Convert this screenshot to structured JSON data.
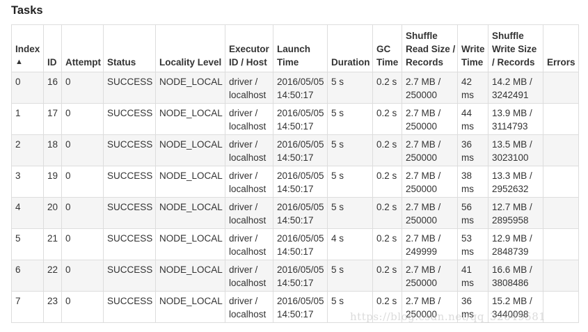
{
  "title": "Tasks",
  "columns": [
    {
      "line1": "Index",
      "line2": "▲"
    },
    {
      "line1": "ID",
      "line2": ""
    },
    {
      "line1": "Attempt",
      "line2": ""
    },
    {
      "line1": "Status",
      "line2": ""
    },
    {
      "line1": "Locality Level",
      "line2": ""
    },
    {
      "line1": "Executor",
      "line2": "ID / Host"
    },
    {
      "line1": "Launch",
      "line2": "Time"
    },
    {
      "line1": "Duration",
      "line2": ""
    },
    {
      "line1": "GC",
      "line2": "Time"
    },
    {
      "line1": "Shuffle",
      "line2": "Read Size /",
      "line3": "Records"
    },
    {
      "line1": "Write",
      "line2": "Time"
    },
    {
      "line1": "Shuffle",
      "line2": "Write Size",
      "line3": "/ Records"
    },
    {
      "line1": "Errors",
      "line2": ""
    }
  ],
  "rows": [
    {
      "index": "0",
      "id": "16",
      "attempt": "0",
      "status": "SUCCESS",
      "locality": "NODE_LOCAL",
      "executor1": "driver /",
      "executor2": "localhost",
      "launch1": "2016/05/05",
      "launch2": "14:50:17",
      "duration": "5 s",
      "gc": "0.2 s",
      "read1": "2.7 MB /",
      "read2": "250000",
      "write1": "42",
      "write2": "ms",
      "wsize1": "14.2 MB /",
      "wsize2": "3242491",
      "errors": ""
    },
    {
      "index": "1",
      "id": "17",
      "attempt": "0",
      "status": "SUCCESS",
      "locality": "NODE_LOCAL",
      "executor1": "driver /",
      "executor2": "localhost",
      "launch1": "2016/05/05",
      "launch2": "14:50:17",
      "duration": "5 s",
      "gc": "0.2 s",
      "read1": "2.7 MB /",
      "read2": "250000",
      "write1": "44",
      "write2": "ms",
      "wsize1": "13.9 MB /",
      "wsize2": "3114793",
      "errors": ""
    },
    {
      "index": "2",
      "id": "18",
      "attempt": "0",
      "status": "SUCCESS",
      "locality": "NODE_LOCAL",
      "executor1": "driver /",
      "executor2": "localhost",
      "launch1": "2016/05/05",
      "launch2": "14:50:17",
      "duration": "5 s",
      "gc": "0.2 s",
      "read1": "2.7 MB /",
      "read2": "250000",
      "write1": "36",
      "write2": "ms",
      "wsize1": "13.5 MB /",
      "wsize2": "3023100",
      "errors": ""
    },
    {
      "index": "3",
      "id": "19",
      "attempt": "0",
      "status": "SUCCESS",
      "locality": "NODE_LOCAL",
      "executor1": "driver /",
      "executor2": "localhost",
      "launch1": "2016/05/05",
      "launch2": "14:50:17",
      "duration": "5 s",
      "gc": "0.2 s",
      "read1": "2.7 MB /",
      "read2": "250000",
      "write1": "38",
      "write2": "ms",
      "wsize1": "13.3 MB /",
      "wsize2": "2952632",
      "errors": ""
    },
    {
      "index": "4",
      "id": "20",
      "attempt": "0",
      "status": "SUCCESS",
      "locality": "NODE_LOCAL",
      "executor1": "driver /",
      "executor2": "localhost",
      "launch1": "2016/05/05",
      "launch2": "14:50:17",
      "duration": "5 s",
      "gc": "0.2 s",
      "read1": "2.7 MB /",
      "read2": "250000",
      "write1": "56",
      "write2": "ms",
      "wsize1": "12.7 MB /",
      "wsize2": "2895958",
      "errors": ""
    },
    {
      "index": "5",
      "id": "21",
      "attempt": "0",
      "status": "SUCCESS",
      "locality": "NODE_LOCAL",
      "executor1": "driver /",
      "executor2": "localhost",
      "launch1": "2016/05/05",
      "launch2": "14:50:17",
      "duration": "4 s",
      "gc": "0.2 s",
      "read1": "2.7 MB /",
      "read2": "249999",
      "write1": "53",
      "write2": "ms",
      "wsize1": "12.9 MB /",
      "wsize2": "2848739",
      "errors": ""
    },
    {
      "index": "6",
      "id": "22",
      "attempt": "0",
      "status": "SUCCESS",
      "locality": "NODE_LOCAL",
      "executor1": "driver /",
      "executor2": "localhost",
      "launch1": "2016/05/05",
      "launch2": "14:50:17",
      "duration": "5 s",
      "gc": "0.2 s",
      "read1": "2.7 MB /",
      "read2": "250000",
      "write1": "41",
      "write2": "ms",
      "wsize1": "16.6 MB /",
      "wsize2": "3808486",
      "errors": ""
    },
    {
      "index": "7",
      "id": "23",
      "attempt": "0",
      "status": "SUCCESS",
      "locality": "NODE_LOCAL",
      "executor1": "driver /",
      "executor2": "localhost",
      "launch1": "2016/05/05",
      "launch2": "14:50:17",
      "duration": "5 s",
      "gc": "0.2 s",
      "read1": "2.7 MB /",
      "read2": "250000",
      "write1": "36",
      "write2": "ms",
      "wsize1": "15.2 MB /",
      "wsize2": "3440098",
      "errors": ""
    }
  ],
  "watermark": "https://blog.csdn.net/qq_32649581"
}
